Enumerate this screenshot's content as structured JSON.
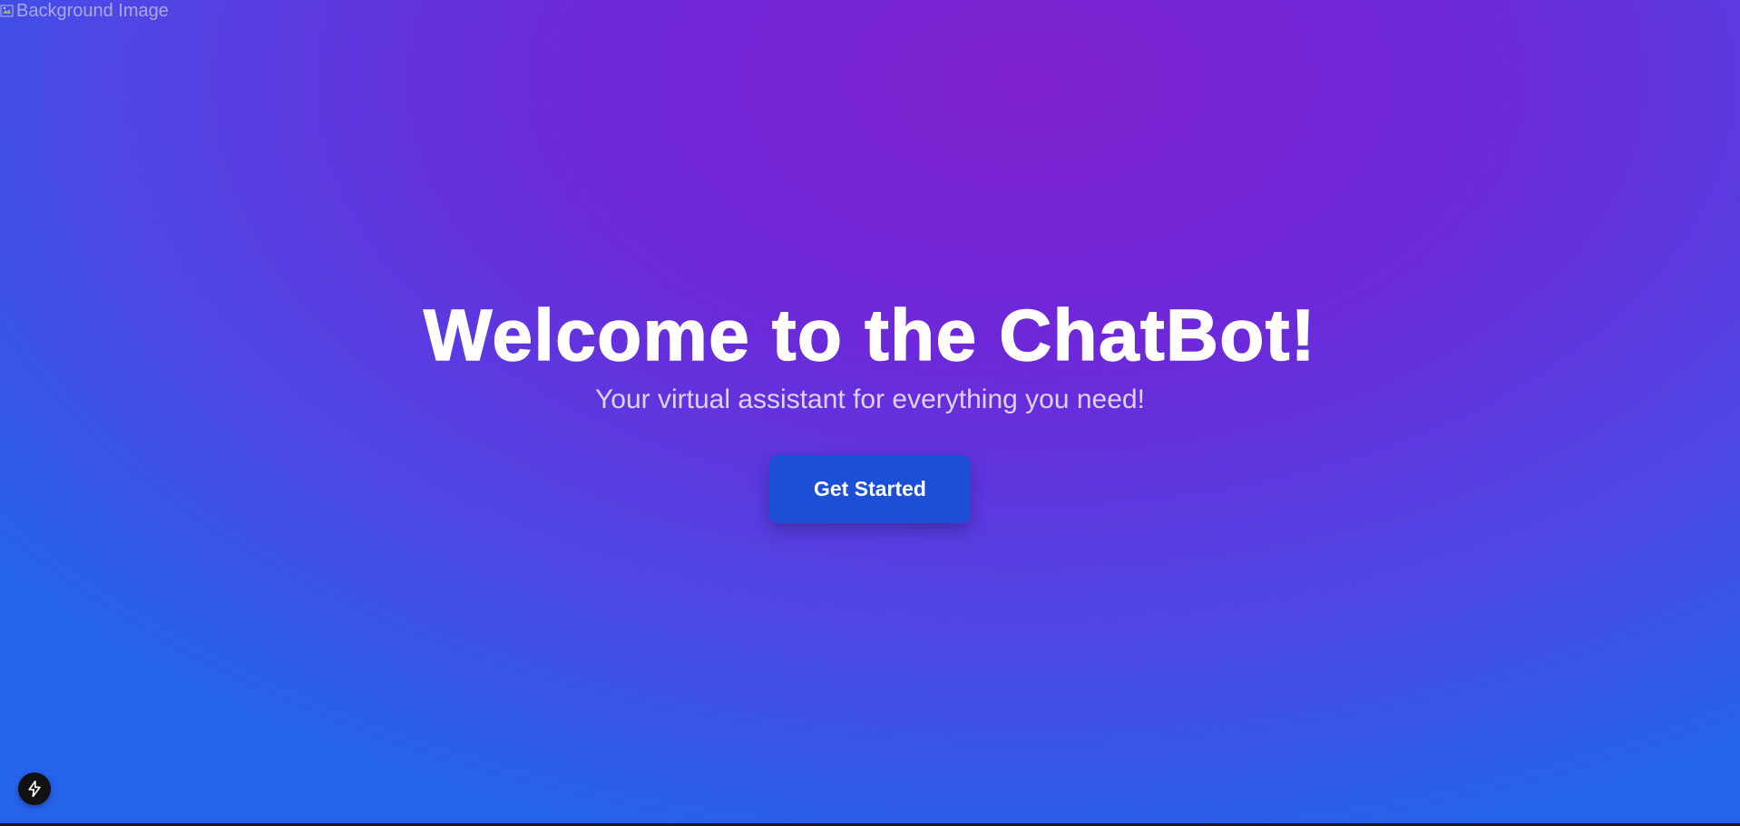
{
  "background": {
    "alt_text": "Background Image",
    "colors": {
      "center": "#7e22ce",
      "mid": "#4f46e5",
      "edge": "#2563eb"
    }
  },
  "hero": {
    "title": "Welcome to the ChatBot!",
    "subtitle": "Your virtual assistant for everything you need!",
    "cta_label": "Get Started",
    "cta_color": "#1d4ed8"
  },
  "dev_indicator": {
    "icon": "lightning-bolt-icon"
  }
}
